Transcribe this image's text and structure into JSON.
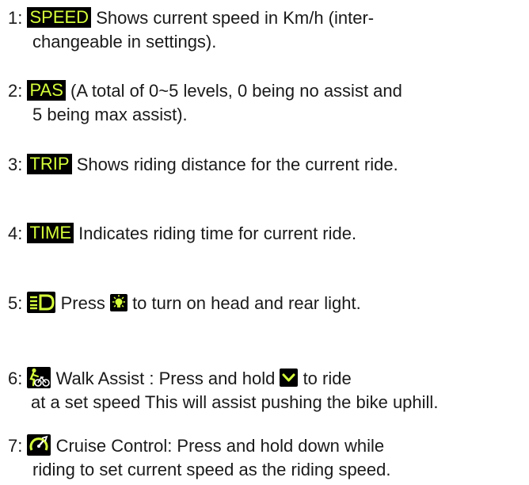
{
  "colors": {
    "yellow": "#d6ff3a",
    "badge_bg": "#000000",
    "text": "#1a1a1a"
  },
  "items": [
    {
      "num": "1:",
      "badge": "SPEED",
      "line1": " Shows current speed in Km/h (inter-",
      "line2": "changeable in settings)."
    },
    {
      "num": "2:",
      "badge": "PAS",
      "line1": " (A total of 0~5 levels, 0 being no assist and",
      "line2": "5 being max assist)."
    },
    {
      "num": "3:",
      "badge": "TRIP",
      "line1": " Shows riding distance for the current ride."
    },
    {
      "num": "4:",
      "badge": "TIME",
      "line1": " Indicates riding time for current ride."
    },
    {
      "num": "5:",
      "icon": "headlight-icon",
      "line1a": " Press ",
      "icon2": "light-button-icon",
      "line1b": " to turn on head and rear light."
    },
    {
      "num": "6:",
      "icon": "walk-assist-icon",
      "line1a": " Walk Assist : Press and hold ",
      "icon2": "chevron-down-icon",
      "line1b": " to ride",
      "line2": "at a set speed This will assist pushing the bike uphill."
    },
    {
      "num": "7:",
      "icon": "cruise-control-icon",
      "line1": " Cruise Control: Press and hold down while",
      "line2": "riding to set current speed as the riding speed."
    }
  ]
}
